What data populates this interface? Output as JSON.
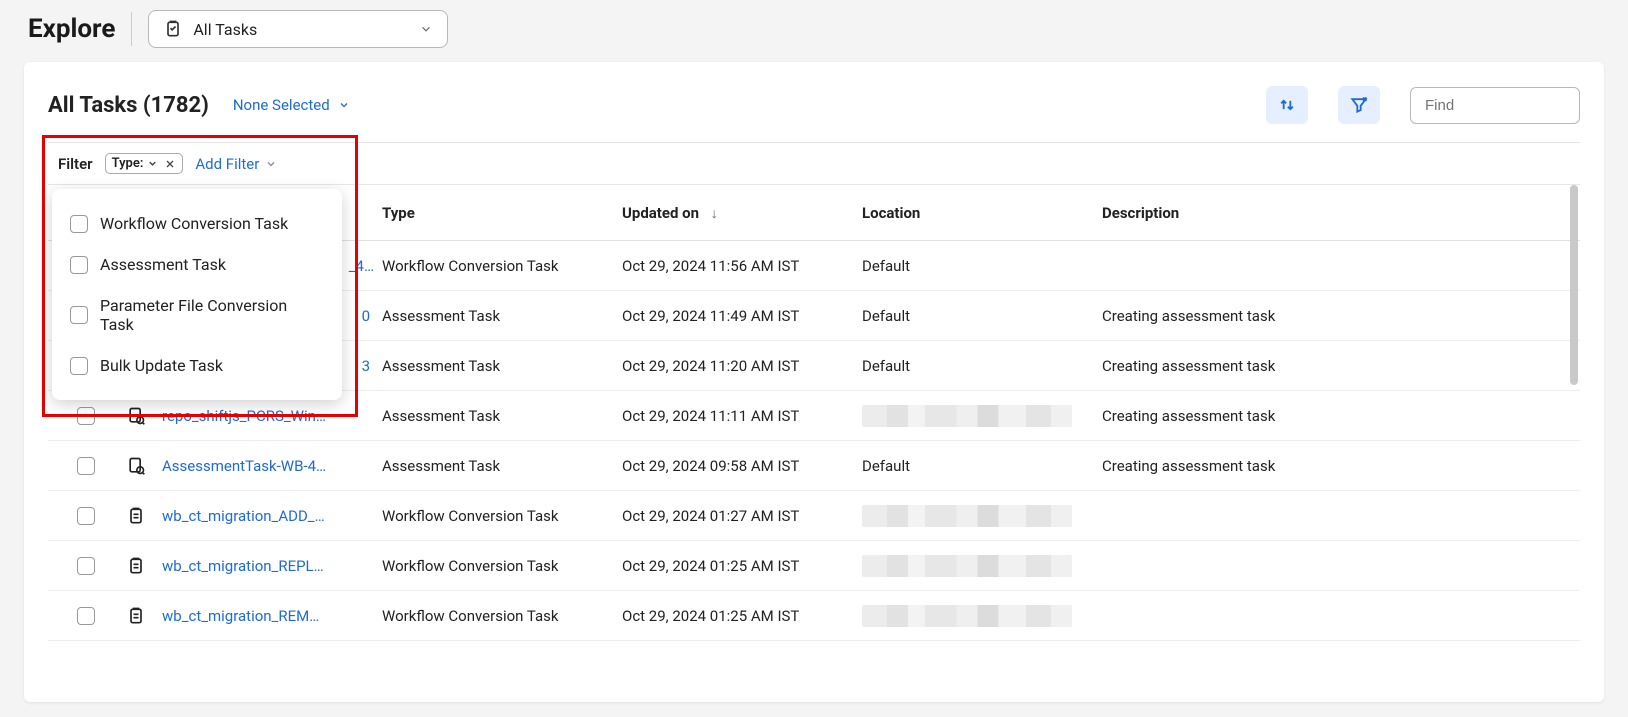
{
  "topbar": {
    "explore": "Explore",
    "selector_label": "All Tasks"
  },
  "panel": {
    "title": "All Tasks (1782)",
    "none_selected": "None Selected",
    "find_placeholder": "Find"
  },
  "filter": {
    "label": "Filter",
    "type_chip": "Type:",
    "add_filter": "Add Filter",
    "options": {
      "0": "Workflow Conversion Task",
      "1": "Assessment Task",
      "2": "Parameter File Conversion Task",
      "3": "Bulk Update Task"
    }
  },
  "columns": {
    "type": "Type",
    "updated": "Updated on",
    "location": "Location",
    "description": "Description"
  },
  "rows": {
    "0": {
      "name_frag": "_4…",
      "type": "Workflow Conversion Task",
      "updated": "Oct 29, 2024 11:56 AM IST",
      "location": "Default",
      "description": ""
    },
    "1": {
      "name_frag": "0",
      "type": "Assessment Task",
      "updated": "Oct 29, 2024 11:49 AM IST",
      "location": "Default",
      "description": "Creating assessment task"
    },
    "2": {
      "name_frag": "3",
      "type": "Assessment Task",
      "updated": "Oct 29, 2024 11:20 AM IST",
      "location": "Default",
      "description": "Creating assessment task"
    },
    "3": {
      "name": "repo_shiftjs_PCRS_Win…",
      "type": "Assessment Task",
      "updated": "Oct 29, 2024 11:11 AM IST",
      "location_blur": true,
      "description": "Creating assessment task"
    },
    "4": {
      "name": "AssessmentTask-WB-4…",
      "type": "Assessment Task",
      "updated": "Oct 29, 2024 09:58 AM IST",
      "location": "Default",
      "description": "Creating assessment task"
    },
    "5": {
      "name": "wb_ct_migration_ADD_…",
      "type": "Workflow Conversion Task",
      "updated": "Oct 29, 2024 01:27 AM IST",
      "location_blur": true,
      "description": ""
    },
    "6": {
      "name": "wb_ct_migration_REPL…",
      "type": "Workflow Conversion Task",
      "updated": "Oct 29, 2024 01:25 AM IST",
      "location_blur": true,
      "description": ""
    },
    "7": {
      "name": "wb_ct_migration_REM…",
      "type": "Workflow Conversion Task",
      "updated": "Oct 29, 2024 01:25 AM IST",
      "location_blur": true,
      "description": ""
    }
  }
}
